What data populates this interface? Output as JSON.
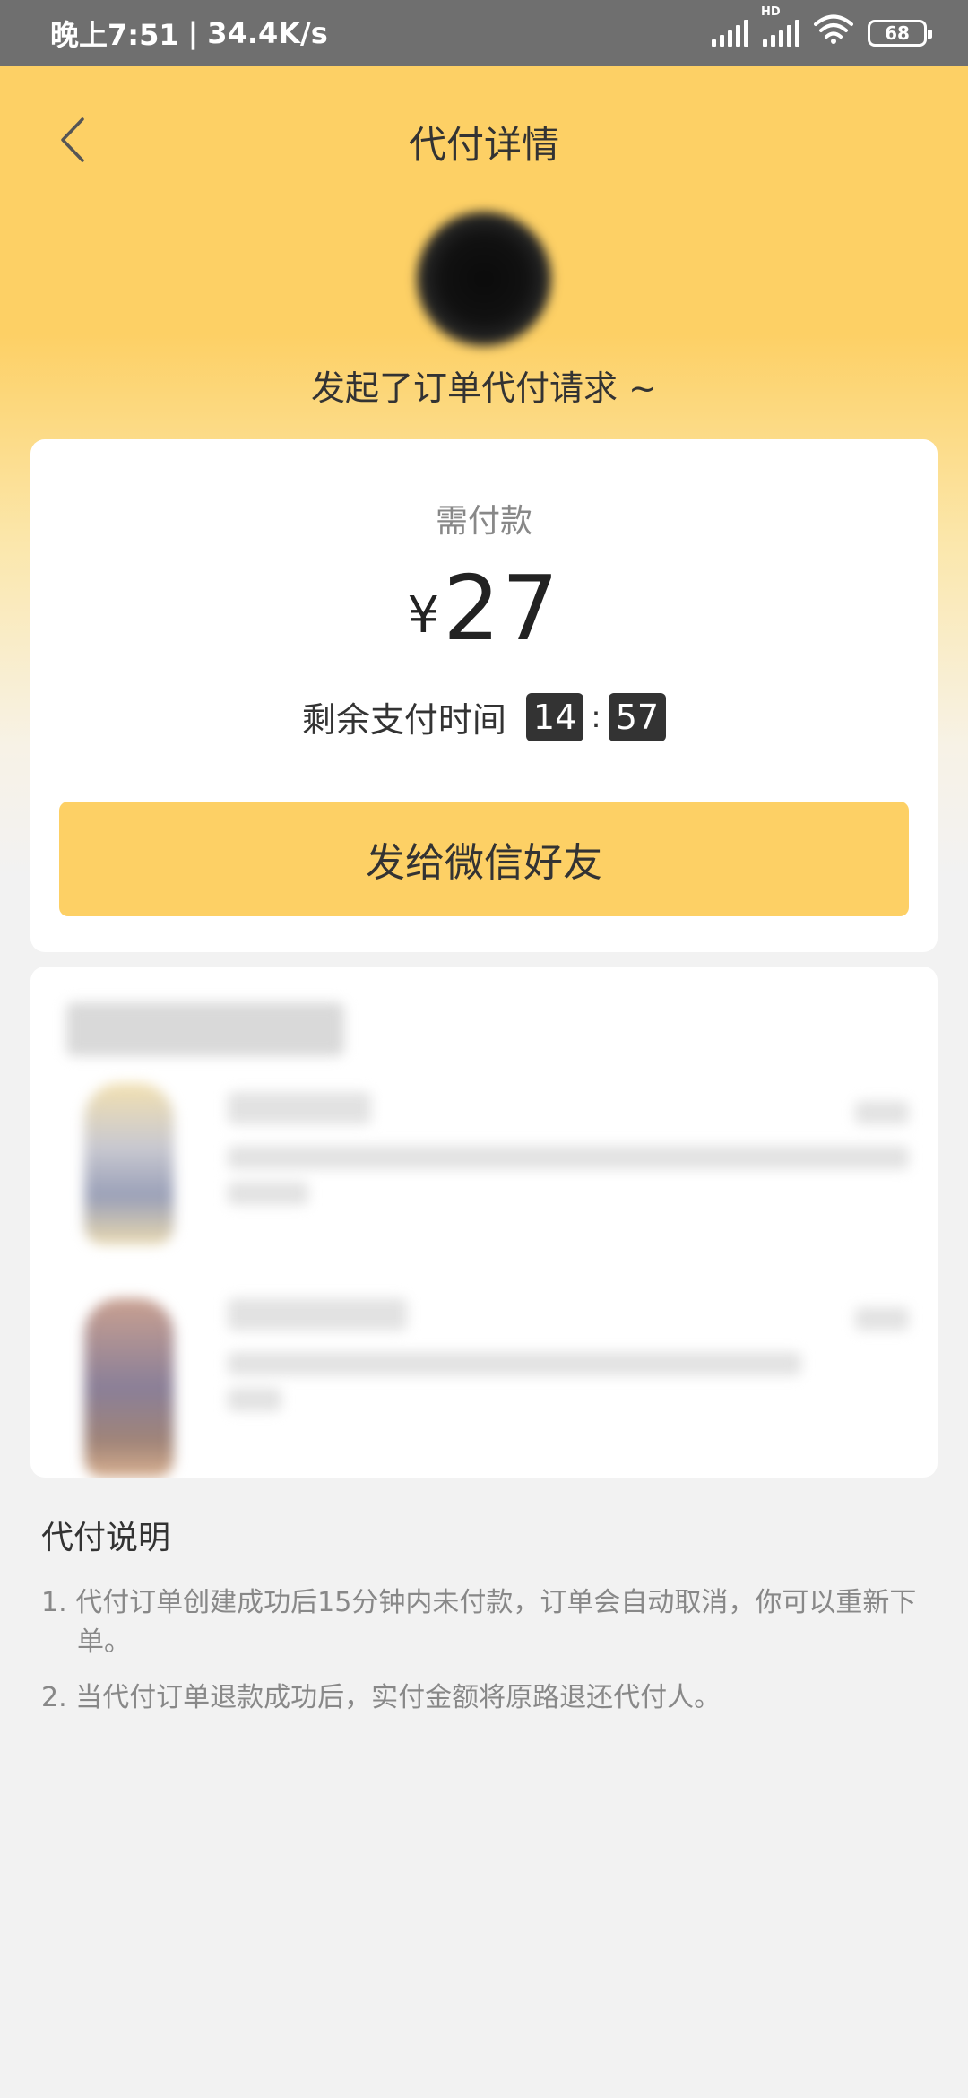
{
  "status_bar": {
    "time": "晚上7:51",
    "network_speed": "34.4K/s",
    "hd_label": "HD",
    "battery": "68",
    "icons": [
      "signal-icon",
      "hd-signal-icon",
      "wifi-icon",
      "battery-icon"
    ]
  },
  "nav": {
    "title": "代付详情",
    "back_icon": "chevron-left-icon"
  },
  "request": {
    "text": "发起了订单代付请求 ~"
  },
  "payment": {
    "label": "需付款",
    "currency": "¥",
    "amount": "27",
    "timer_label": "剩余支付时间",
    "minutes": "14",
    "separator": ":",
    "seconds": "57",
    "share_button": "发给微信好友"
  },
  "notes": {
    "title": "代付说明",
    "items": [
      "1. 代付订单创建成功后15分钟内未付款，订单会自动取消，你可以重新下单。",
      "2. 当代付订单退款成功后，实付金额将原路退还代付人。"
    ]
  },
  "colors": {
    "brand_yellow": "#fdd065",
    "page_bg": "#f2f2f2",
    "status_bar_bg": "#6f6f6f",
    "timer_box": "#333333"
  }
}
